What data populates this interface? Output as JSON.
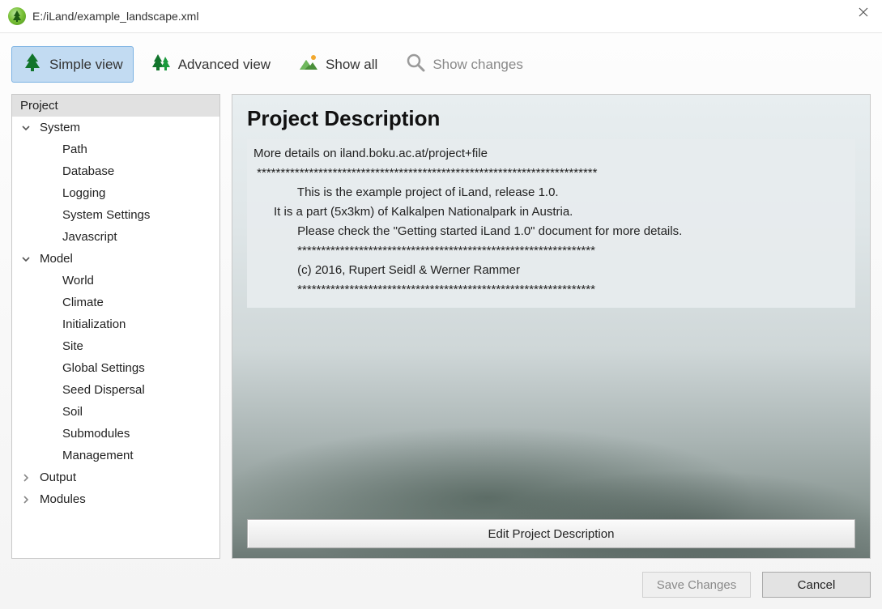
{
  "window": {
    "title": "E:/iLand/example_landscape.xml"
  },
  "toolbar": {
    "simple_view": "Simple view",
    "advanced_view": "Advanced view",
    "show_all": "Show all",
    "show_changes": "Show changes"
  },
  "tree": {
    "items": [
      {
        "label": "Project",
        "type": "top",
        "selected": true
      },
      {
        "label": "System",
        "type": "group",
        "expanded": true,
        "children": [
          {
            "label": "Path"
          },
          {
            "label": "Database"
          },
          {
            "label": "Logging"
          },
          {
            "label": "System Settings"
          },
          {
            "label": "Javascript"
          }
        ]
      },
      {
        "label": "Model",
        "type": "group",
        "expanded": true,
        "children": [
          {
            "label": "World"
          },
          {
            "label": "Climate"
          },
          {
            "label": "Initialization"
          },
          {
            "label": "Site"
          },
          {
            "label": "Global Settings"
          },
          {
            "label": "Seed Dispersal"
          },
          {
            "label": "Soil"
          },
          {
            "label": "Submodules"
          },
          {
            "label": "Management"
          }
        ]
      },
      {
        "label": "Output",
        "type": "group",
        "expanded": false
      },
      {
        "label": "Modules",
        "type": "group",
        "expanded": false
      }
    ]
  },
  "detail": {
    "heading": "Project Description",
    "intro": "More details on iland.boku.ac.at/project+file",
    "lines": [
      " ************************************************************************",
      "             This is the example project of iLand, release 1.0.",
      "      It is a part (5x3km) of Kalkalpen Nationalpark in Austria.",
      "             Please check the \"Getting started iLand 1.0\" document for more details.",
      "             ***************************************************************",
      "             (c) 2016, Rupert Seidl & Werner Rammer",
      "             ***************************************************************"
    ],
    "edit_label": "Edit Project Description"
  },
  "footer": {
    "save": "Save Changes",
    "cancel": "Cancel"
  }
}
